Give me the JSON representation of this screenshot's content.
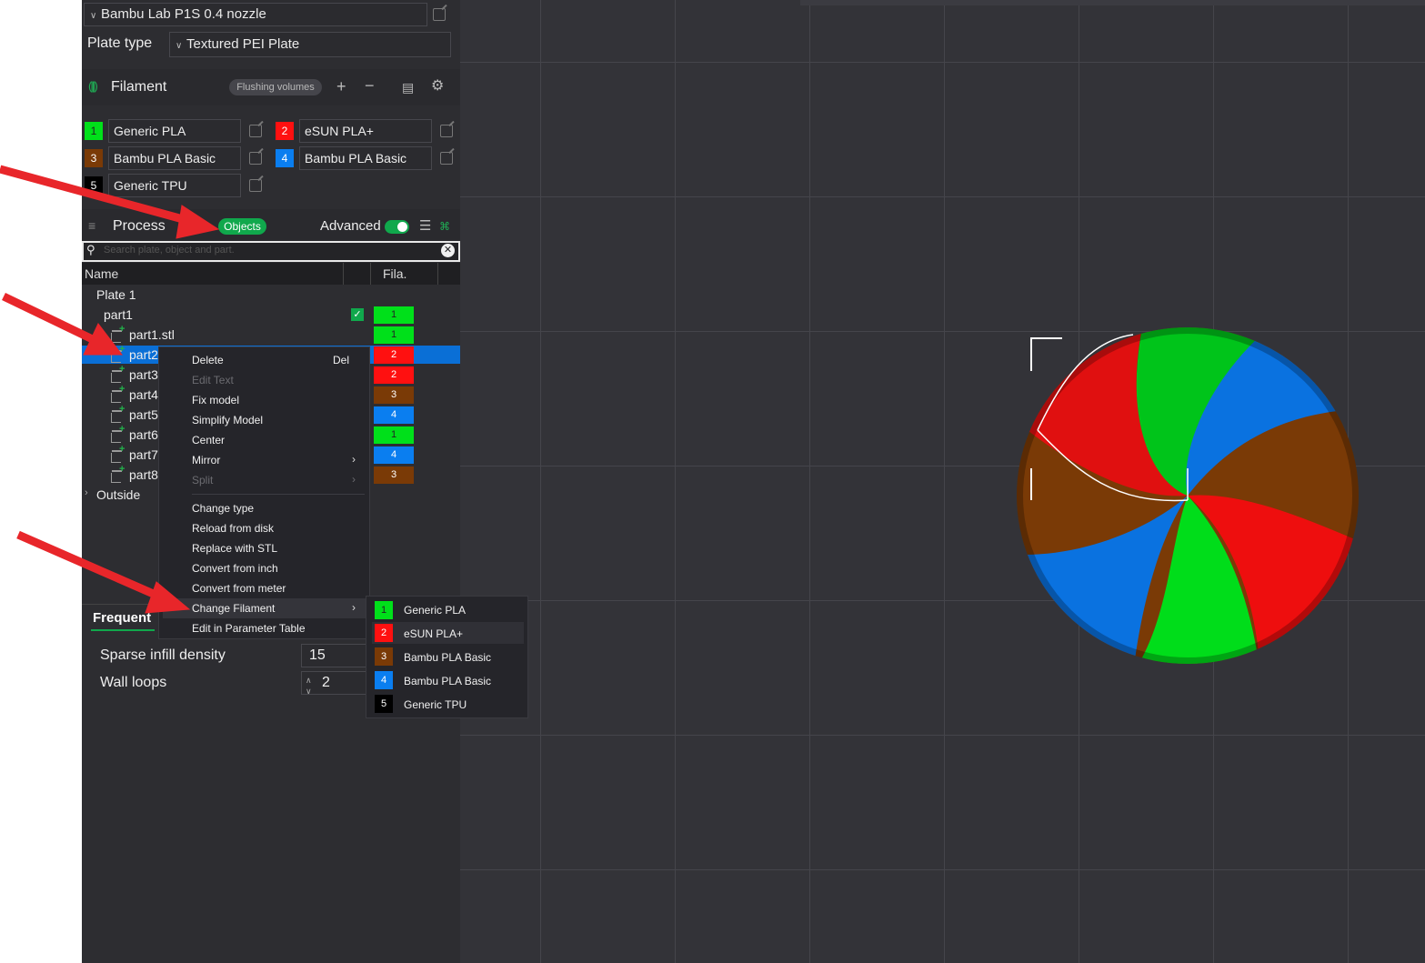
{
  "printer": {
    "label": "Bambu Lab P1S 0.4 nozzle"
  },
  "plate_type": {
    "label": "Plate type",
    "value": "Textured PEI Plate"
  },
  "filament_section": {
    "title": "Filament",
    "flushing_button": "Flushing volumes",
    "add_icon": "plus-icon",
    "remove_icon": "minus-icon",
    "items": [
      {
        "index": "1",
        "name": "Generic PLA",
        "color": "#00e01a"
      },
      {
        "index": "2",
        "name": "eSUN PLA+",
        "color": "#ff1010"
      },
      {
        "index": "3",
        "name": "Bambu PLA Basic",
        "color": "#7a3a06"
      },
      {
        "index": "4",
        "name": "Bambu PLA Basic",
        "color": "#0a7ef0"
      },
      {
        "index": "5",
        "name": "Generic TPU",
        "color": "#000000"
      }
    ]
  },
  "process_section": {
    "title": "Process",
    "objects_toggle": "Objects",
    "advanced_label": "Advanced",
    "advanced_on": true
  },
  "search": {
    "placeholder": "Search plate, object and part."
  },
  "object_list": {
    "columns": [
      "Name",
      "Fila."
    ],
    "plate": "Plate 1",
    "object": "part1",
    "object_fila": "1",
    "parts": [
      {
        "name": "part1.stl",
        "fila": "1",
        "color": "#00e01a"
      },
      {
        "name": "part2",
        "fila": "2",
        "color": "#ff1010"
      },
      {
        "name": "part3",
        "fila": "2",
        "color": "#ff1010"
      },
      {
        "name": "part4",
        "fila": "3",
        "color": "#7a3a06"
      },
      {
        "name": "part5",
        "fila": "4",
        "color": "#0a7ef0"
      },
      {
        "name": "part6",
        "fila": "1",
        "color": "#00e01a"
      },
      {
        "name": "part7",
        "fila": "4",
        "color": "#0a7ef0"
      },
      {
        "name": "part8",
        "fila": "3",
        "color": "#7a3a06"
      }
    ],
    "outside": "Outside"
  },
  "params": {
    "tab": "Frequent",
    "sparse_infill_label": "Sparse infill density",
    "sparse_infill_value": "15",
    "wall_loops_label": "Wall loops",
    "wall_loops_value": "2"
  },
  "context_menu": {
    "items": [
      {
        "label": "Delete",
        "shortcut": "Del",
        "disabled": false
      },
      {
        "label": "Edit Text",
        "disabled": true
      },
      {
        "label": "Fix model",
        "disabled": false
      },
      {
        "label": "Simplify Model",
        "disabled": false
      },
      {
        "label": "Center",
        "disabled": false
      },
      {
        "label": "Mirror",
        "disabled": false,
        "submenu": true
      },
      {
        "label": "Split",
        "disabled": true,
        "submenu": true
      },
      {
        "label": "Change type",
        "disabled": false
      },
      {
        "label": "Reload from disk",
        "disabled": false
      },
      {
        "label": "Replace with STL",
        "disabled": false
      },
      {
        "label": "Convert from inch",
        "disabled": false
      },
      {
        "label": "Convert from meter",
        "disabled": false
      },
      {
        "label": "Change Filament",
        "disabled": false,
        "submenu": true,
        "highlighted": true
      },
      {
        "label": "Edit in Parameter Table",
        "disabled": false
      }
    ]
  },
  "filament_submenu": {
    "items": [
      {
        "index": "1",
        "name": "Generic PLA",
        "color": "#00e01a"
      },
      {
        "index": "2",
        "name": "eSUN PLA+",
        "color": "#ff1010",
        "highlighted": true
      },
      {
        "index": "3",
        "name": "Bambu PLA Basic",
        "color": "#7a3a06"
      },
      {
        "index": "4",
        "name": "Bambu PLA Basic",
        "color": "#0a7ef0"
      },
      {
        "index": "5",
        "name": "Generic TPU",
        "color": "#000000"
      }
    ]
  },
  "colors": {
    "sidebar_bg": "#2d2d31",
    "viewport_bg": "#333338",
    "accent_green": "#009a49",
    "selection_blue": "#0a6fd6",
    "annotation_red": "#e8262a"
  }
}
